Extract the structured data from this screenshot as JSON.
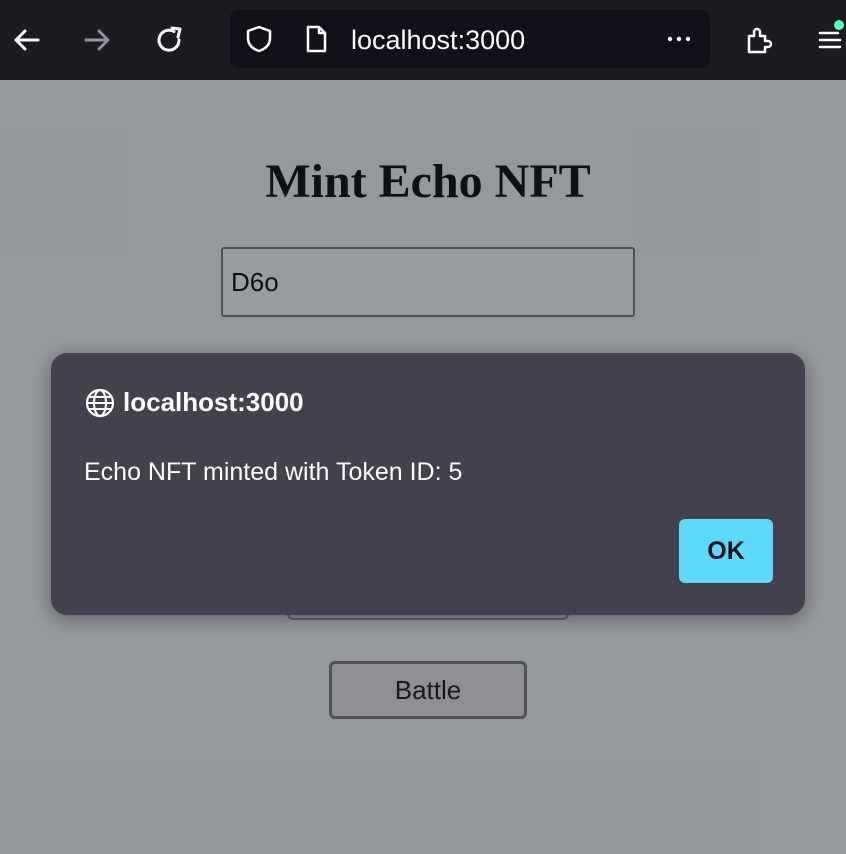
{
  "browser": {
    "url": "localhost:3000",
    "icons": {
      "back": "arrow-left-icon",
      "forward": "arrow-right-icon",
      "reload": "reload-icon",
      "shield": "shield-icon",
      "page": "page-icon",
      "more": "more-dots-icon",
      "extensions": "puzzle-icon",
      "menu": "menu-icon"
    }
  },
  "page": {
    "title": "Mint Echo NFT",
    "name_input_value": "D6o",
    "battle_label": "Battle"
  },
  "dialog": {
    "origin": "localhost:3000",
    "message": "Echo NFT minted with Token ID: 5",
    "ok_label": "OK"
  },
  "colors": {
    "toolbar_bg": "#1c1b22",
    "dialog_bg": "#42414d",
    "accent_button": "#5fd9f9",
    "notification_dot": "#54ffbd"
  }
}
